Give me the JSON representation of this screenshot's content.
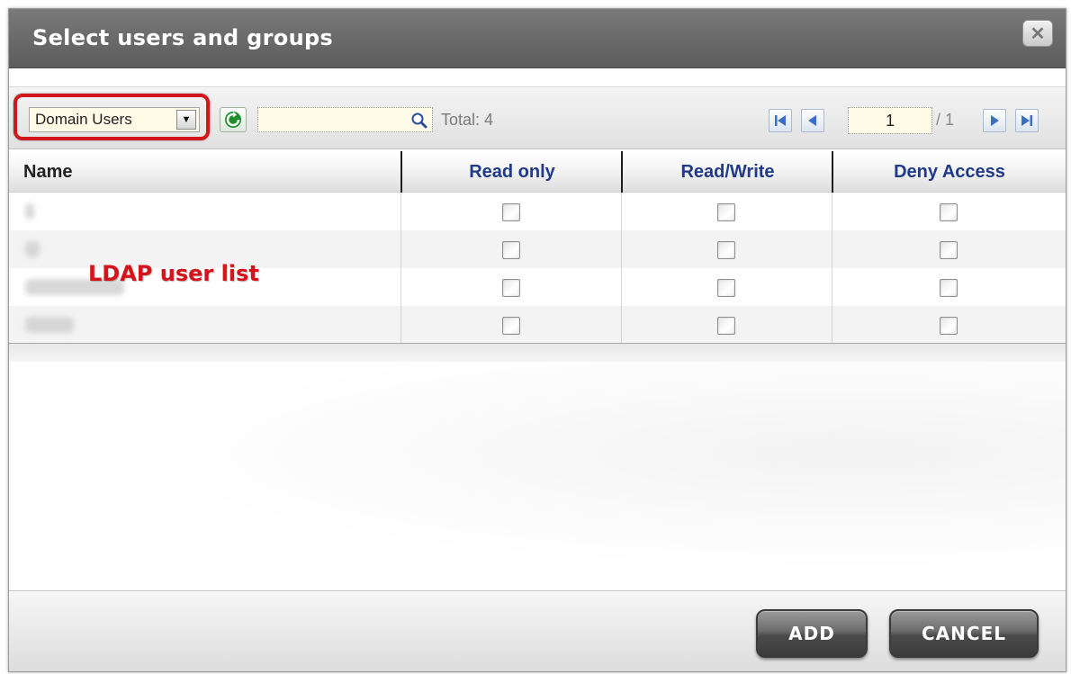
{
  "dialog": {
    "title": "Select users and groups",
    "close_icon": "close-icon"
  },
  "toolbar": {
    "group_select_value": "Domain Users",
    "search_value": "",
    "total_label": "Total:",
    "total_count": "4",
    "page_current": "1",
    "page_total": "/ 1",
    "colors": {
      "highlight": "#d0181b",
      "input_bg": "#fffbe6",
      "pager_blue": "#3a6fc4",
      "refresh_green": "#1e8f2a"
    }
  },
  "table": {
    "columns": [
      "Name",
      "Read only",
      "Read/Write",
      "Deny Access"
    ],
    "rows": [
      {
        "name": "",
        "read_only": false,
        "read_write": false,
        "deny_access": false
      },
      {
        "name": "",
        "read_only": false,
        "read_write": false,
        "deny_access": false
      },
      {
        "name": "",
        "read_only": false,
        "read_write": false,
        "deny_access": false
      },
      {
        "name": "",
        "read_only": false,
        "read_write": false,
        "deny_access": false
      }
    ]
  },
  "annotation": "LDAP user list",
  "footer": {
    "add_label": "ADD",
    "cancel_label": "CANCEL"
  }
}
